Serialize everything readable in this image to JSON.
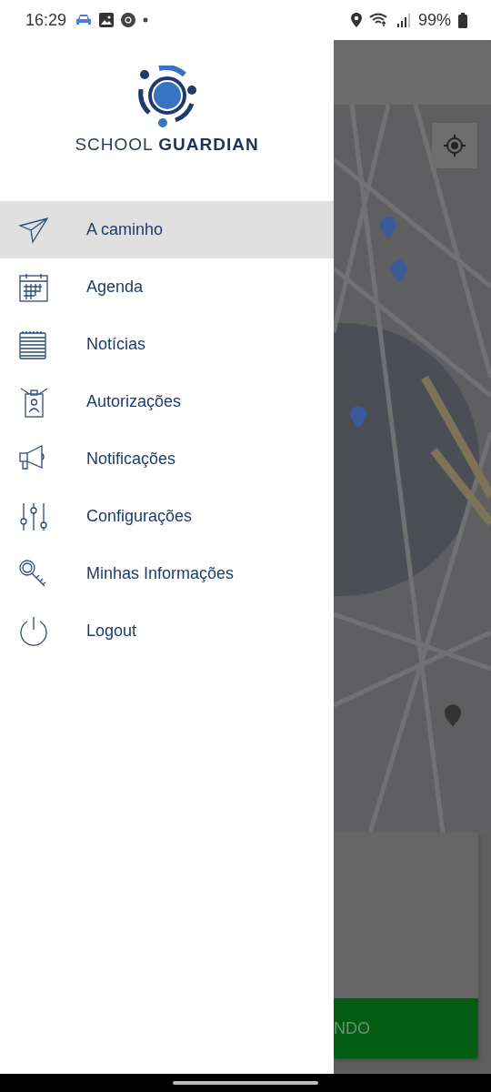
{
  "status_bar": {
    "time": "16:29",
    "battery": "99%"
  },
  "drawer": {
    "brand": {
      "light": "SCHOOL",
      "bold": "GUARDIAN"
    },
    "items": [
      {
        "label": "A caminho",
        "kind": "send",
        "selected": true
      },
      {
        "label": "Agenda",
        "kind": "calendar",
        "selected": false
      },
      {
        "label": "Notícias",
        "kind": "notepad",
        "selected": false
      },
      {
        "label": "Autorizações",
        "kind": "badge",
        "selected": false
      },
      {
        "label": "Notificações",
        "kind": "megaphone",
        "selected": false
      },
      {
        "label": "Configurações",
        "kind": "sliders",
        "selected": false
      },
      {
        "label": "Minhas Informações",
        "kind": "key",
        "selected": false
      },
      {
        "label": "Logout",
        "kind": "power",
        "selected": false
      }
    ]
  },
  "bottom_button": {
    "label": "NDO"
  }
}
